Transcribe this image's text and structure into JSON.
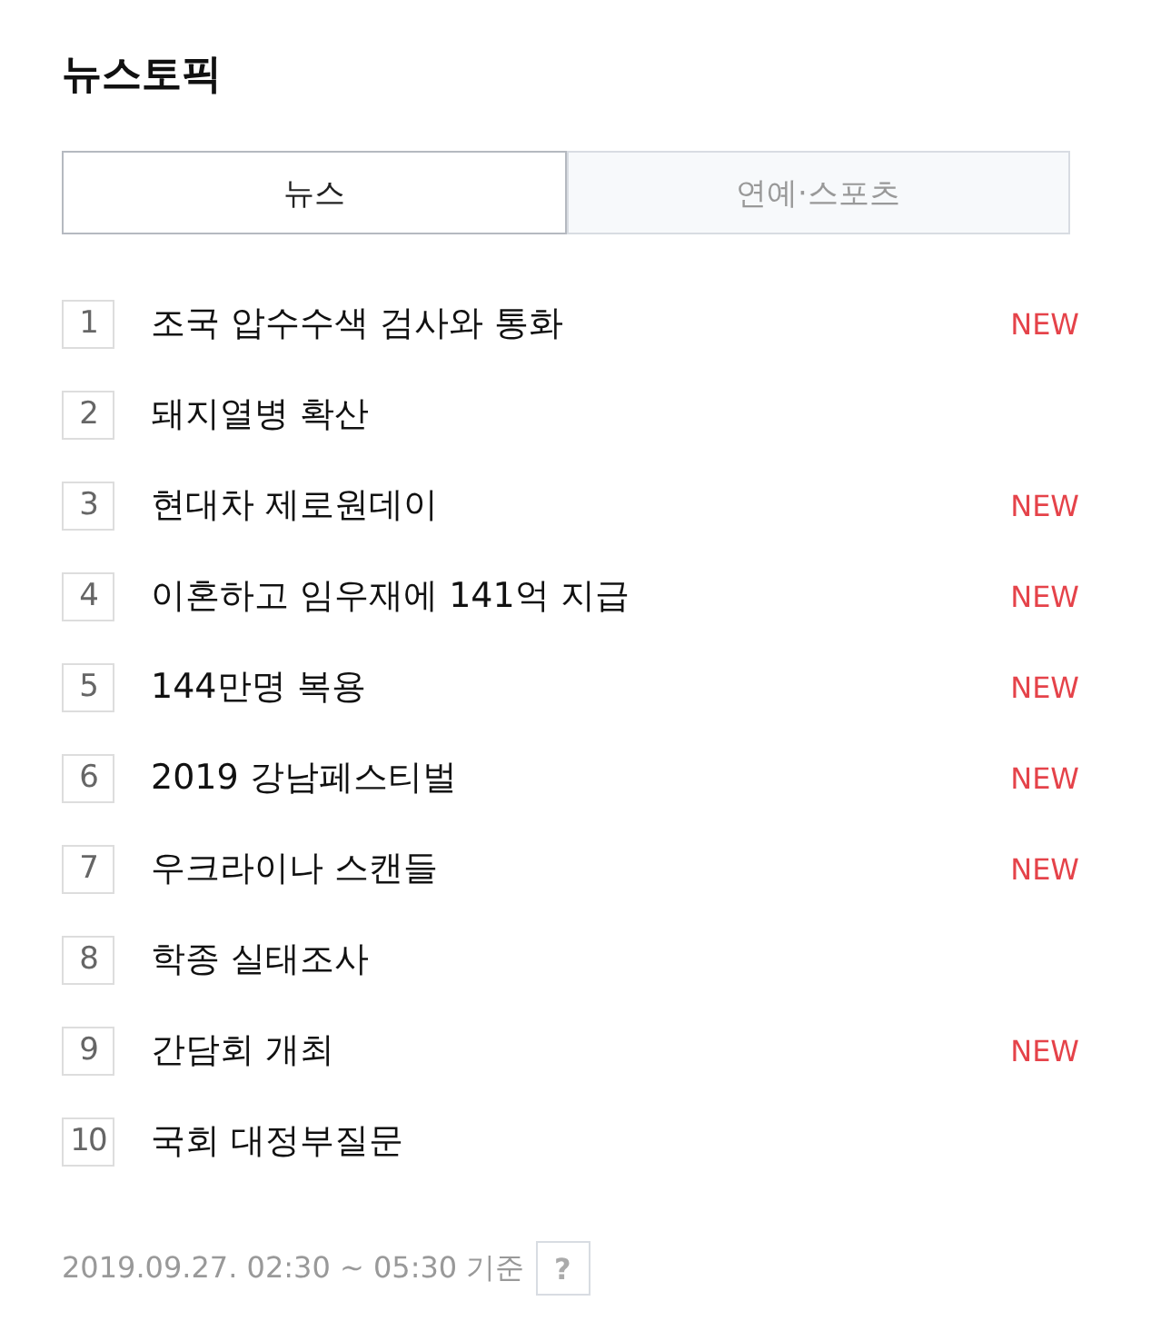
{
  "title": "뉴스토픽",
  "tabs": [
    {
      "label": "뉴스",
      "selected": true
    },
    {
      "label": "연예·스포츠",
      "selected": false
    }
  ],
  "topics": [
    {
      "rank": "1",
      "text": "조국 압수수색 검사와 통화",
      "badge": "NEW"
    },
    {
      "rank": "2",
      "text": "돼지열병 확산"
    },
    {
      "rank": "3",
      "text": "현대차 제로원데이",
      "badge": "NEW"
    },
    {
      "rank": "4",
      "text": "이혼하고 임우재에 141억 지급",
      "badge": "NEW"
    },
    {
      "rank": "5",
      "text": "144만명 복용",
      "badge": "NEW"
    },
    {
      "rank": "6",
      "text": "2019 강남페스티벌",
      "badge": "NEW"
    },
    {
      "rank": "7",
      "text": "우크라이나 스캔들",
      "badge": "NEW"
    },
    {
      "rank": "8",
      "text": "학종 실태조사"
    },
    {
      "rank": "9",
      "text": "간담회 개최",
      "badge": "NEW"
    },
    {
      "rank": "10",
      "text": "국회 대정부질문"
    }
  ],
  "footer": {
    "timestamp": "2019.09.27. 02:30 ~ 05:30 기준",
    "help": "?"
  }
}
